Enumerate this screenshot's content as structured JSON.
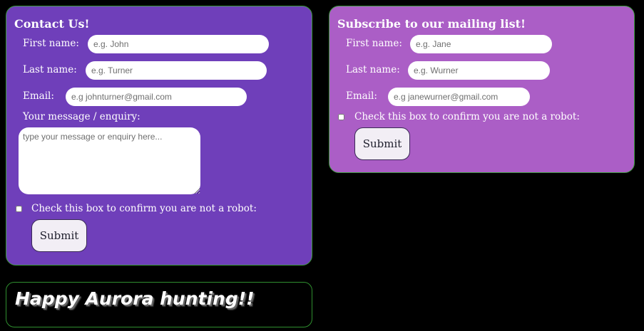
{
  "contact": {
    "title": "Contact Us!",
    "first_name_label": "First name:",
    "first_name_placeholder": "e.g. John",
    "last_name_label": "Last name:",
    "last_name_placeholder": "e.g. Turner",
    "email_label": "Email:",
    "email_placeholder": "e.g johnturner@gmail.com",
    "message_label": "Your message / enquiry:",
    "message_placeholder": "type your message or enquiry here...",
    "robot_label": "Check this box to confirm you are not a robot:",
    "submit_label": "Submit"
  },
  "subscribe": {
    "title": "Subscribe to our mailing list!",
    "first_name_label": "First name:",
    "first_name_placeholder": "e.g. Jane",
    "last_name_label": "Last name:",
    "last_name_placeholder": "e.g. Wurner",
    "email_label": "Email:",
    "email_placeholder": "e.g janewurner@gmail.com",
    "robot_label": "Check this box to confirm you are not a robot:",
    "submit_label": "Submit"
  },
  "banner": {
    "text": "Happy Aurora hunting!!"
  },
  "colors": {
    "contact_bg": "#6f3fba",
    "subscribe_bg": "#ab5ec6",
    "page_bg": "#000000",
    "panel_border": "#3d9a3d"
  }
}
